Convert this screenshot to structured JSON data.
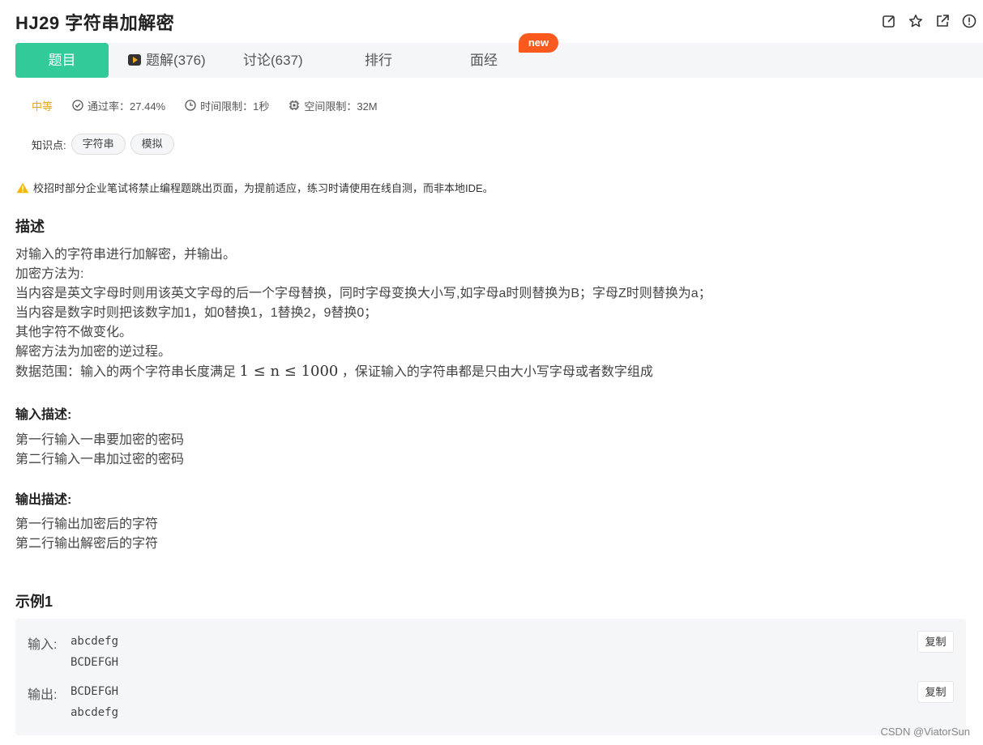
{
  "header": {
    "title": "HJ29  字符串加解密",
    "actions": [
      "edit-icon",
      "star-icon",
      "share-icon",
      "report-icon"
    ]
  },
  "tabs": [
    {
      "label": "题目",
      "active": true
    },
    {
      "label": "题解(376)",
      "icon": "video-icon"
    },
    {
      "label": "讨论(637)"
    },
    {
      "label": "排行"
    },
    {
      "label": "面经"
    }
  ],
  "new_badge": "new",
  "meta": {
    "difficulty": "中等",
    "pass_rate": "通过率：27.44%",
    "time_limit": "时间限制：1秒",
    "memory_limit": "空间限制：32M"
  },
  "tags": {
    "label": "知识点:",
    "items": [
      "字符串",
      "模拟"
    ]
  },
  "notice": "校招时部分企业笔试将禁止编程题跳出页面，为提前适应，练习时请使用在线自测，而非本地IDE。",
  "description": {
    "heading": "描述",
    "lines": [
      "对输入的字符串进行加解密，并输出。",
      "加密方法为:",
      "当内容是英文字母时则用该英文字母的后一个字母替换，同时字母变换大小写,如字母a时则替换为B；字母Z时则替换为a；",
      "当内容是数字时则把该数字加1，如0替换1，1替换2，9替换0；",
      "其他字符不做变化。",
      "解密方法为加密的逆过程。"
    ],
    "range_prefix": "数据范围：输入的两个字符串长度满足",
    "range_math": "1 ≤ n ≤ 1000",
    "range_suffix": "，保证输入的字符串都是只由大小写字母或者数字组成"
  },
  "input_desc": {
    "heading": "输入描述:",
    "lines": [
      "第一行输入一串要加密的密码",
      "第二行输入一串加过密的密码"
    ]
  },
  "output_desc": {
    "heading": "输出描述:",
    "lines": [
      "第一行输出加密后的字符",
      "第二行输出解密后的字符"
    ]
  },
  "example": {
    "heading": "示例1",
    "input_label": "输入:",
    "input_lines": [
      "abcdefg",
      "BCDEFGH"
    ],
    "output_label": "输出:",
    "output_lines": [
      "BCDEFGH",
      "abcdefg"
    ],
    "copy_label": "复制"
  },
  "watermark": "CSDN @ViatorSun",
  "colors": {
    "accent": "#32ca99",
    "difficulty": "#e8a317",
    "badge": "#fa5a1e",
    "warning": "#f5b800"
  }
}
